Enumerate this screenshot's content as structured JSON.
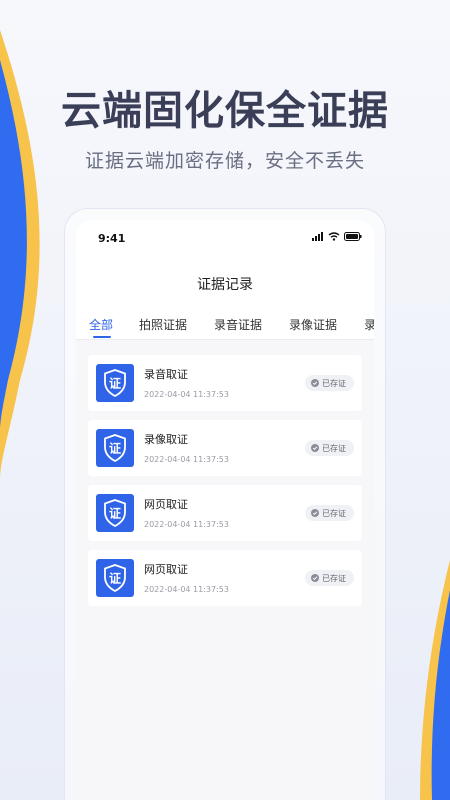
{
  "colors": {
    "accent": "#2f64e8",
    "decor_blue": "#2f6cf0",
    "decor_yellow": "#f7c34a",
    "headline": "#3a3f57"
  },
  "promo": {
    "headline": "云端固化保全证据",
    "subline": "证据云端加密存储，安全不丢失"
  },
  "phone": {
    "status_time": "9:41",
    "status_icons": [
      "signal-icon",
      "wifi-icon",
      "battery-icon"
    ],
    "page_title": "证据记录",
    "tabs": [
      {
        "label": "全部",
        "active": true
      },
      {
        "label": "拍照证据",
        "active": false
      },
      {
        "label": "录音证据",
        "active": false
      },
      {
        "label": "录像证据",
        "active": false
      },
      {
        "label": "录",
        "active": false
      }
    ],
    "records": [
      {
        "icon_text": "证",
        "title": "录音取证",
        "time": "2022-04-04 11:37:53",
        "status": "已存证"
      },
      {
        "icon_text": "证",
        "title": "录像取证",
        "time": "2022-04-04 11:37:53",
        "status": "已存证"
      },
      {
        "icon_text": "证",
        "title": "网页取证",
        "time": "2022-04-04 11:37:53",
        "status": "已存证"
      },
      {
        "icon_text": "证",
        "title": "网页取证",
        "time": "2022-04-04 11:37:53",
        "status": "已存证"
      }
    ]
  }
}
